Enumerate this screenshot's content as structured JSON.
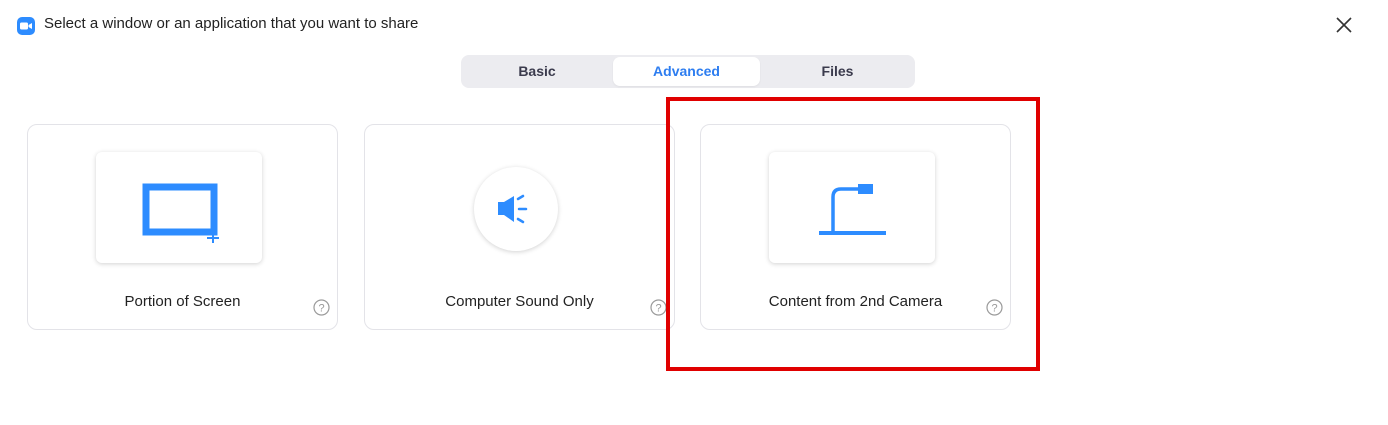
{
  "window": {
    "title": "Select a window or an application that you want to share",
    "app_icon": "zoom-camera-icon",
    "close_icon": "close-icon"
  },
  "tabs": [
    {
      "label": "Basic",
      "active": false
    },
    {
      "label": "Advanced",
      "active": true
    },
    {
      "label": "Files",
      "active": false
    }
  ],
  "options": [
    {
      "label": "Portion of Screen",
      "icon": "portion-of-screen-icon",
      "help_icon": "help-icon"
    },
    {
      "label": "Computer Sound Only",
      "icon": "speaker-icon",
      "help_icon": "help-icon"
    },
    {
      "label": "Content from 2nd Camera",
      "icon": "document-camera-icon",
      "help_icon": "help-icon",
      "highlighted": true
    }
  ],
  "colors": {
    "accent": "#2D8CFF",
    "active_tab_text": "#2D7DF0",
    "highlight": "#E00000",
    "tab_bg": "#ECECF0"
  }
}
